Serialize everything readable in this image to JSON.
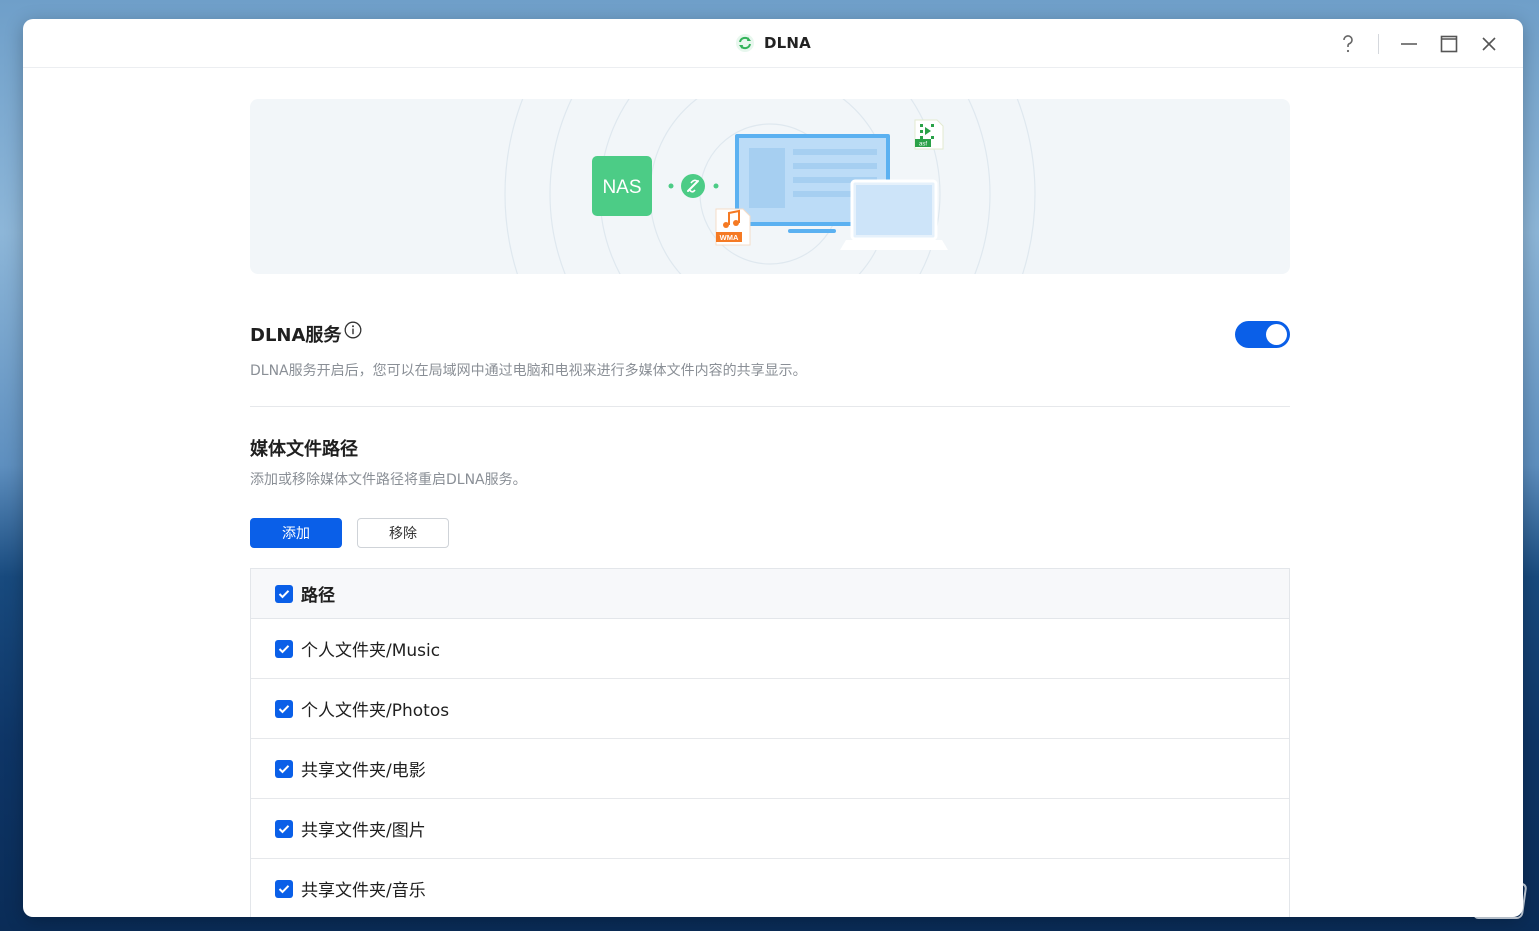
{
  "window": {
    "title": "DLNA",
    "controls": [
      "help-icon",
      "minimize-icon",
      "maximize-icon",
      "close-icon"
    ]
  },
  "banner": {
    "nas_label": "NAS",
    "file_badges": [
      "asf",
      "WMA"
    ],
    "colors": {
      "nas": "#4ccc86",
      "screen": "#5bb1f1",
      "link": "#4ccc86",
      "wma": "#f57a24",
      "asf": "#2aa148"
    }
  },
  "service": {
    "title": "DLNA服务",
    "enabled": true,
    "description": "DLNA服务开启后，您可以在局域网中通过电脑和电视来进行多媒体文件内容的共享显示。"
  },
  "media_paths": {
    "title": "媒体文件路径",
    "description": "添加或移除媒体文件路径将重启DLNA服务。",
    "add_label": "添加",
    "remove_label": "移除",
    "table": {
      "header": "路径",
      "header_checked": true,
      "rows": [
        {
          "path": "个人文件夹/Music",
          "checked": true
        },
        {
          "path": "个人文件夹/Photos",
          "checked": true
        },
        {
          "path": "共享文件夹/电影",
          "checked": true
        },
        {
          "path": "共享文件夹/图片",
          "checked": true
        },
        {
          "path": "共享文件夹/音乐",
          "checked": true
        }
      ]
    }
  },
  "theme": {
    "accent": "#0a5fe8"
  }
}
